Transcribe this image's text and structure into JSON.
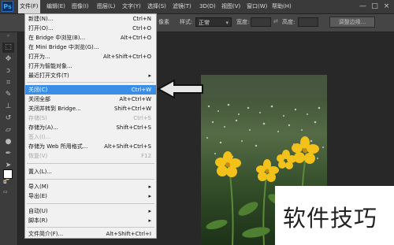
{
  "app": {
    "logo": "Ps"
  },
  "menubar": {
    "items": [
      "文件(F)",
      "编辑(E)",
      "图像(I)",
      "图层(L)",
      "文字(Y)",
      "选择(S)",
      "滤镜(T)",
      "3D(D)",
      "视图(V)",
      "窗口(W)",
      "帮助(H)"
    ],
    "window_controls": [
      "—",
      "□",
      "×"
    ]
  },
  "options_bar": {
    "feather_fragment": "像素",
    "style_label": "样式:",
    "style_value": "正常",
    "width_label": "宽度:",
    "height_label": "高度:",
    "refine_edge_label": "调整边缘..."
  },
  "file_menu": {
    "items": [
      {
        "label": "新建(N)...",
        "shortcut": "Ctrl+N",
        "submenu": false,
        "disabled": false,
        "highlighted": false
      },
      {
        "label": "打开(O)...",
        "shortcut": "Ctrl+O",
        "submenu": false,
        "disabled": false,
        "highlighted": false
      },
      {
        "label": "在 Bridge 中浏览(B)...",
        "shortcut": "Alt+Ctrl+O",
        "submenu": false,
        "disabled": false,
        "highlighted": false
      },
      {
        "label": "在 Mini Bridge 中浏览(G)...",
        "shortcut": "",
        "submenu": false,
        "disabled": false,
        "highlighted": false
      },
      {
        "label": "打开为...",
        "shortcut": "Alt+Shift+Ctrl+O",
        "submenu": false,
        "disabled": false,
        "highlighted": false
      },
      {
        "label": "打开为智能对象...",
        "shortcut": "",
        "submenu": false,
        "disabled": false,
        "highlighted": false
      },
      {
        "label": "最近打开文件(T)",
        "shortcut": "",
        "submenu": true,
        "disabled": false,
        "highlighted": false
      },
      {
        "label": "关闭(C)",
        "shortcut": "Ctrl+W",
        "submenu": false,
        "disabled": false,
        "highlighted": true
      },
      {
        "label": "关闭全部",
        "shortcut": "Alt+Ctrl+W",
        "submenu": false,
        "disabled": false,
        "highlighted": false
      },
      {
        "label": "关闭并转到 Bridge...",
        "shortcut": "Shift+Ctrl+W",
        "submenu": false,
        "disabled": false,
        "highlighted": false
      },
      {
        "label": "存储(S)",
        "shortcut": "Ctrl+S",
        "submenu": false,
        "disabled": true,
        "highlighted": false
      },
      {
        "label": "存储为(A)...",
        "shortcut": "Shift+Ctrl+S",
        "submenu": false,
        "disabled": false,
        "highlighted": false
      },
      {
        "label": "签入(I)...",
        "shortcut": "",
        "submenu": false,
        "disabled": true,
        "highlighted": false
      },
      {
        "label": "存储为 Web 所用格式...",
        "shortcut": "Alt+Shift+Ctrl+S",
        "submenu": false,
        "disabled": false,
        "highlighted": false
      },
      {
        "label": "恢复(V)",
        "shortcut": "F12",
        "submenu": false,
        "disabled": true,
        "highlighted": false
      },
      {
        "label": "置入(L)...",
        "shortcut": "",
        "submenu": false,
        "disabled": false,
        "highlighted": false
      },
      {
        "label": "导入(M)",
        "shortcut": "",
        "submenu": true,
        "disabled": false,
        "highlighted": false
      },
      {
        "label": "导出(E)",
        "shortcut": "",
        "submenu": true,
        "disabled": false,
        "highlighted": false
      },
      {
        "label": "自动(U)",
        "shortcut": "",
        "submenu": true,
        "disabled": false,
        "highlighted": false
      },
      {
        "label": "脚本(R)",
        "shortcut": "",
        "submenu": true,
        "disabled": false,
        "highlighted": false
      },
      {
        "label": "文件简介(F)...",
        "shortcut": "Alt+Shift+Ctrl+I",
        "submenu": false,
        "disabled": false,
        "highlighted": false
      }
    ]
  },
  "watermark": {
    "text": "软件技巧"
  },
  "colors": {
    "highlight": "#3b8ee5",
    "menubar": "#3a3a3a",
    "workspace": "#282828",
    "menu_bg": "#f1f1f1"
  }
}
